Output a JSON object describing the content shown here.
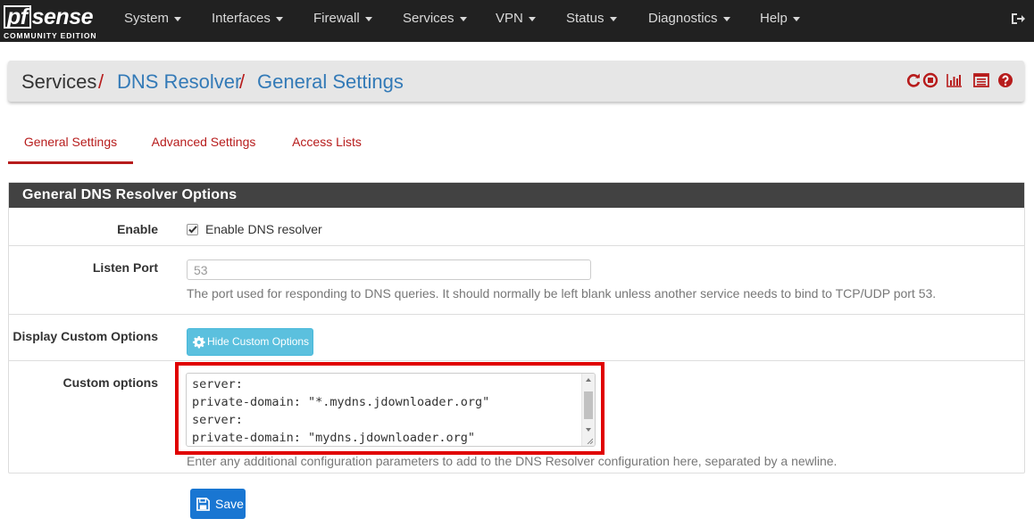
{
  "brand": {
    "name_prefix": "pf",
    "name_suffix": "sense",
    "edition": "COMMUNITY EDITION"
  },
  "nav": {
    "items": [
      {
        "label": "System"
      },
      {
        "label": "Interfaces"
      },
      {
        "label": "Firewall"
      },
      {
        "label": "Services"
      },
      {
        "label": "VPN"
      },
      {
        "label": "Status"
      },
      {
        "label": "Diagnostics"
      },
      {
        "label": "Help"
      }
    ],
    "logout_icon": "sign-out-icon"
  },
  "breadcrumb": {
    "root": "Services",
    "sep": "/",
    "level1": "DNS Resolver",
    "level2": "General Settings",
    "icons": [
      "restart-icon",
      "stop-icon",
      "status-chart-icon",
      "log-icon",
      "help-icon"
    ]
  },
  "tabs": [
    {
      "label": "General Settings",
      "active": true
    },
    {
      "label": "Advanced Settings",
      "active": false
    },
    {
      "label": "Access Lists",
      "active": false
    }
  ],
  "section": {
    "title": "General DNS Resolver Options",
    "enable": {
      "label": "Enable",
      "checkbox_label": "Enable DNS resolver",
      "checked": true
    },
    "listen_port": {
      "label": "Listen Port",
      "placeholder": "53",
      "help": "The port used for responding to DNS queries. It should normally be left blank unless another service needs to bind to TCP/UDP port 53."
    },
    "display_custom": {
      "label": "Display Custom Options",
      "button_label": "Hide Custom Options",
      "button_icon": "gear-icon"
    },
    "custom_options": {
      "label": "Custom options",
      "lines": [
        "server:",
        "private-domain: \"*.mydns.jdownloader.org\"",
        "server:",
        "private-domain: \"mydns.jdownloader.org\""
      ],
      "help": "Enter any additional configuration parameters to add to the DNS Resolver configuration here, separated by a newline."
    }
  },
  "actions": {
    "save_label": "Save",
    "save_icon": "save-icon"
  },
  "colors": {
    "accent_red": "#b71c1c",
    "link_blue": "#337ab7",
    "navbar": "#212121",
    "info": "#5bc0de",
    "primary": "#1976d2",
    "highlight": "#e00000"
  }
}
